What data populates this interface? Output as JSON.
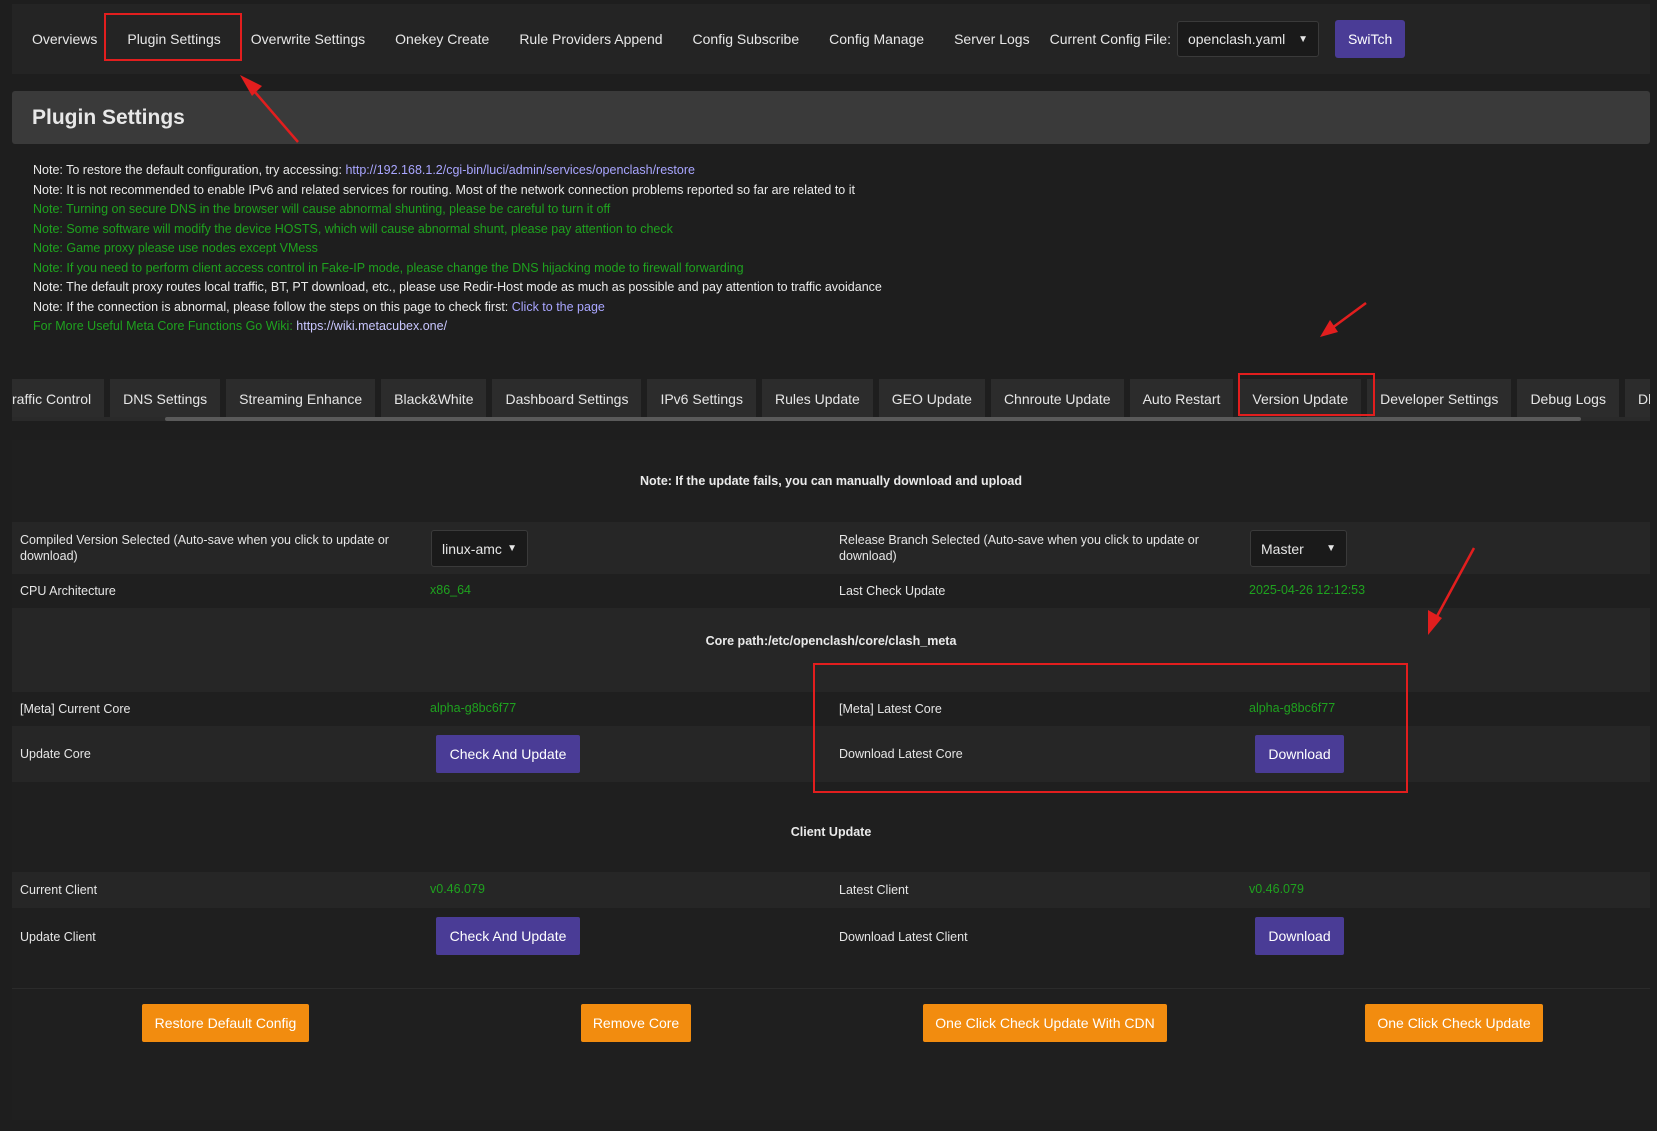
{
  "top_nav": {
    "tabs": [
      "Overviews",
      "Plugin Settings",
      "Overwrite Settings",
      "Onekey Create",
      "Rule Providers Append",
      "Config Subscribe",
      "Config Manage",
      "Server Logs"
    ],
    "active": "Plugin Settings",
    "config_label": "Current Config File:",
    "config_value": "openclash.yaml",
    "switch_label": "SwiTch"
  },
  "page_title": "Plugin Settings",
  "notes": [
    {
      "prefix": "Note: To restore the default configuration, try accessing: ",
      "link": "http://192.168.1.2/cgi-bin/luci/admin/services/openclash/restore",
      "color": "white"
    },
    {
      "prefix": "Note: It is not recommended to enable IPv6 and related services for routing. Most of the network connection problems reported so far are related to it",
      "color": "white"
    },
    {
      "prefix": "Note: Turning on secure DNS in the browser will cause abnormal shunting, please be careful to turn it off",
      "color": "green"
    },
    {
      "prefix": "Note: Some software will modify the device HOSTS, which will cause abnormal shunt, please pay attention to check",
      "color": "green"
    },
    {
      "prefix": "Note: Game proxy please use nodes except VMess",
      "color": "green"
    },
    {
      "prefix": "Note: If you need to perform client access control in Fake-IP mode, please change the DNS hijacking mode to firewall forwarding",
      "color": "green"
    },
    {
      "prefix": "Note: The default proxy routes local traffic, BT, PT download, etc., please use Redir-Host mode as much as possible and pay attention to traffic avoidance",
      "color": "white"
    },
    {
      "prefix": "Note: If the connection is abnormal, please follow the steps on this page to check first: ",
      "link": "Click to the page",
      "color": "white"
    },
    {
      "prefix": "For More Useful Meta Core Functions Go Wiki: ",
      "link": "https://wiki.metacubex.one/",
      "color": "green"
    }
  ],
  "sub_tabs": [
    "raffic Control",
    "DNS Settings",
    "Streaming Enhance",
    "Black&White",
    "Dashboard Settings",
    "IPv6 Settings",
    "Rules Update",
    "GEO Update",
    "Chnroute Update",
    "Auto Restart",
    "Version Update",
    "Developer Settings",
    "Debug Logs",
    "Dle"
  ],
  "active_sub_tab": "Version Update",
  "version": {
    "update_note": "Note: If the update fails, you can manually download and upload",
    "compiled_label": "Compiled Version Selected (Auto-save when you click to update or download)",
    "compiled_value": "linux-amc",
    "branch_label": "Release Branch Selected (Auto-save when you click to update or download)",
    "branch_value": "Master",
    "cpu_label": "CPU Architecture",
    "cpu_value": "x86_64",
    "last_check_label": "Last Check Update",
    "last_check_value": "2025-04-26 12:12:53",
    "core_path": "Core path:/etc/openclash/core/clash_meta",
    "current_core_label": "[Meta] Current Core",
    "current_core_value": "alpha-g8bc6f77",
    "latest_core_label": "[Meta] Latest Core",
    "latest_core_value": "alpha-g8bc6f77",
    "update_core_label": "Update Core",
    "check_update_label": "Check And Update",
    "download_core_label": "Download Latest Core",
    "download_label": "Download",
    "client_update_title": "Client Update",
    "current_client_label": "Current Client",
    "current_client_value": "v0.46.079",
    "latest_client_label": "Latest Client",
    "latest_client_value": "v0.46.079",
    "update_client_label": "Update Client",
    "download_client_label": "Download Latest Client"
  },
  "actions": {
    "restore": "Restore Default Config",
    "remove_core": "Remove Core",
    "cdn_check": "One Click Check Update With CDN",
    "check": "One Click Check Update"
  },
  "colors": {
    "accent": "#4a3c96",
    "orange": "#f28c0f",
    "green": "#1fa21f",
    "annotation": "#e21e1e"
  }
}
